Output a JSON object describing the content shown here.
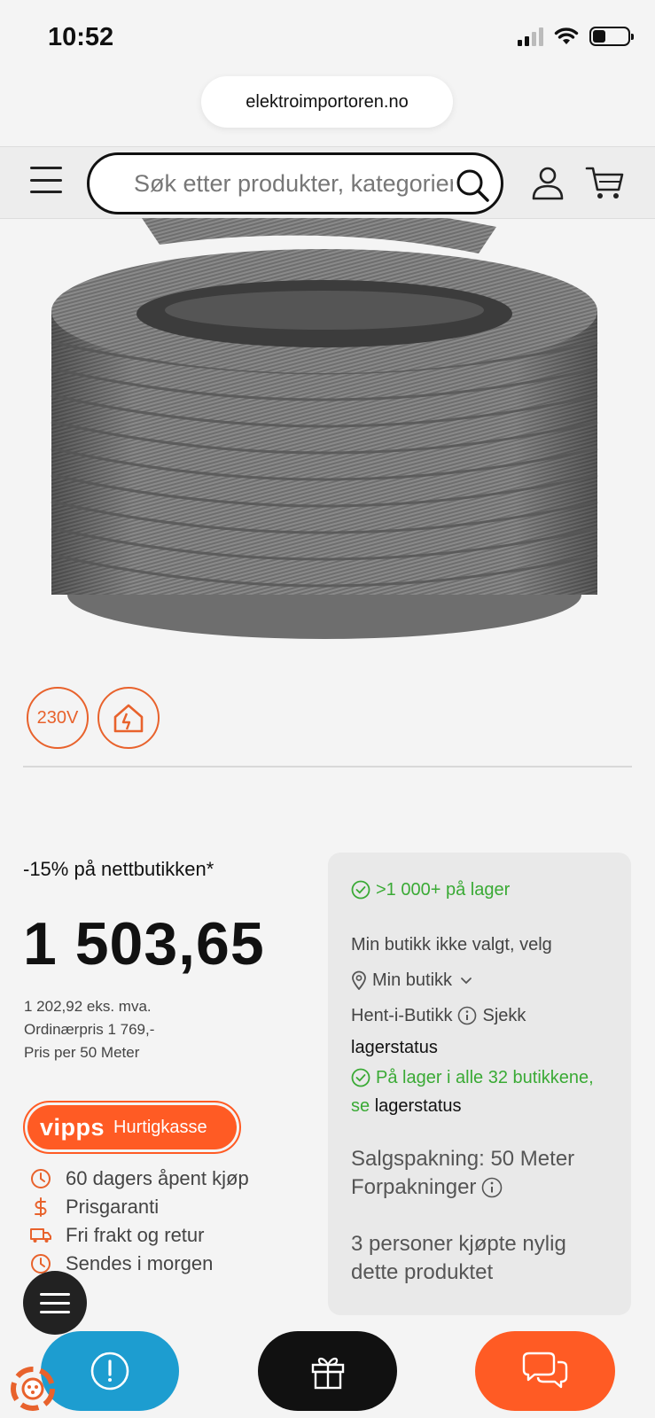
{
  "status_bar": {
    "time": "10:52"
  },
  "browser": {
    "url": "elektroimportoren.no"
  },
  "header": {
    "search_placeholder": "Søk etter produkter, kategorier"
  },
  "badges": {
    "voltage": "230V"
  },
  "pricing": {
    "discount": "-15% på nettbutikken*",
    "price": "1 503,65",
    "ex_vat": "1 202,92 eks. mva.",
    "ordinary": "Ordinærpris 1 769,-",
    "per_unit": "Pris per 50 Meter"
  },
  "vipps": {
    "logo": "vipps",
    "label": "Hurtigkasse"
  },
  "usps": [
    {
      "icon": "clock-icon",
      "text": "60 dagers åpent kjøp"
    },
    {
      "icon": "dollar-icon",
      "text": "Prisgaranti"
    },
    {
      "icon": "truck-icon",
      "text": "Fri frakt og retur"
    },
    {
      "icon": "clock-icon",
      "text": "Sendes i morgen"
    }
  ],
  "stock": {
    "online": ">1 000+ på lager",
    "store_not_selected": "Min butikk ikke valgt, velg",
    "my_store": "Min butikk",
    "pickup": "Hent-i-Butikk",
    "check": "Sjekk",
    "lagerstatus": "lagerstatus",
    "all_stores": "På lager i alle 32 butikkene,",
    "se": "se",
    "lagerstatus2": "lagerstatus",
    "package": "Salgspakning: 50 Meter",
    "packages": "Forpakninger",
    "recent": "3 personer kjøpte nylig dette produktet"
  },
  "colors": {
    "accent": "#e8622c",
    "vipps": "#ff5b24",
    "green": "#3aaa35",
    "info": "#1d9dd0"
  }
}
